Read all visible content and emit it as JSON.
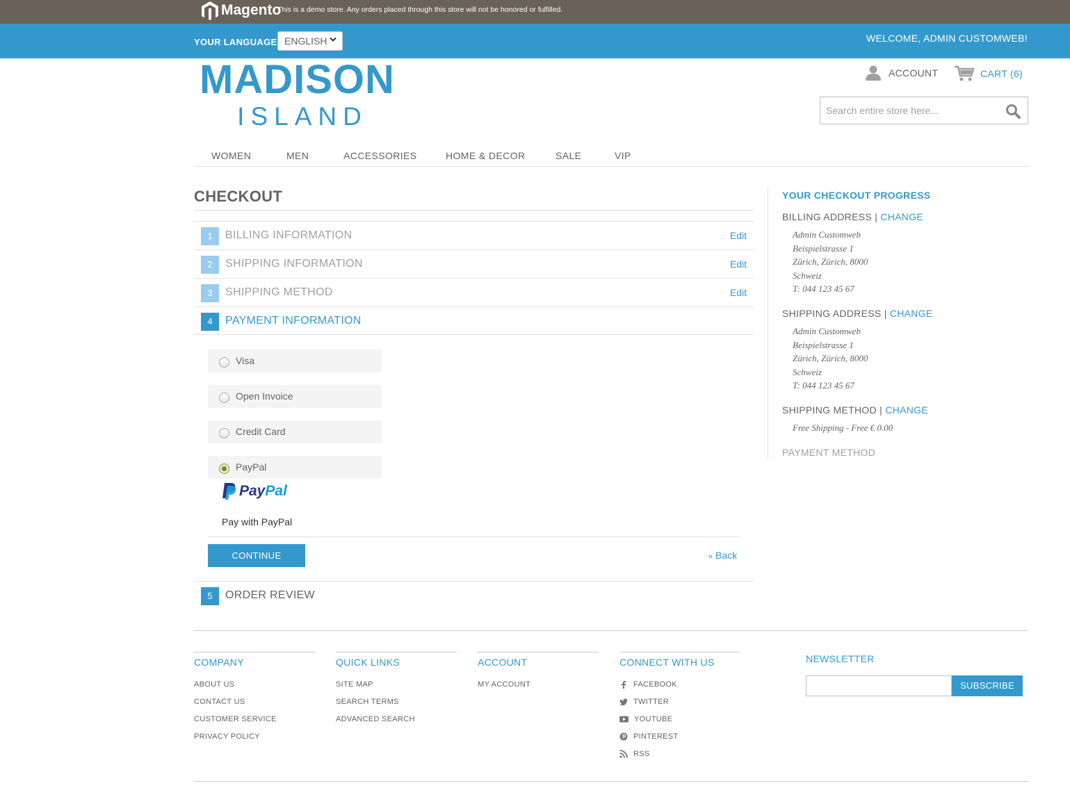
{
  "demo_notice": {
    "brand": "Magento",
    "text": "This is a demo store. Any orders placed through this store will not be honored or fulfilled."
  },
  "language": {
    "label": "YOUR LANGUAGE:",
    "selected": "ENGLISH"
  },
  "welcome": "WELCOME, ADMIN CUSTOMWEB!",
  "logo": {
    "top": "MADISON",
    "bottom": "ISLAND"
  },
  "header": {
    "account_label": "ACCOUNT",
    "cart_label": "CART (6)",
    "search_placeholder": "Search entire store here..."
  },
  "nav": [
    "WOMEN",
    "MEN",
    "ACCESSORIES",
    "HOME & DECOR",
    "SALE",
    "VIP"
  ],
  "checkout": {
    "title": "CHECKOUT",
    "steps": [
      {
        "num": "1",
        "label": "BILLING INFORMATION",
        "edit": "Edit"
      },
      {
        "num": "2",
        "label": "SHIPPING INFORMATION",
        "edit": "Edit"
      },
      {
        "num": "3",
        "label": "SHIPPING METHOD",
        "edit": "Edit"
      },
      {
        "num": "4",
        "label": "PAYMENT INFORMATION"
      },
      {
        "num": "5",
        "label": "ORDER REVIEW"
      }
    ],
    "payment_options": [
      "Visa",
      "Open Invoice",
      "Credit Card",
      "PayPal"
    ],
    "selected_payment": "PayPal",
    "paypal_logo_text": "PayPal",
    "pay_with": "Pay with PayPal",
    "continue_label": "CONTINUE",
    "back_label": "Back"
  },
  "progress": {
    "title": "YOUR CHECKOUT PROGRESS",
    "change_label": "CHANGE",
    "billing_heading": "BILLING ADDRESS",
    "billing_address": [
      "Admin Customweb",
      "Beispielstrasse 1",
      "Zürich, Zürich, 8000",
      "Schweiz",
      "T: 044 123 45 67"
    ],
    "shipping_heading": "SHIPPING ADDRESS",
    "shipping_address": [
      "Admin Customweb",
      "Beispielstrasse 1",
      "Zürich, Zürich, 8000",
      "Schweiz",
      "T: 044 123 45 67"
    ],
    "method_heading": "SHIPPING METHOD",
    "method_value": "Free Shipping - Free € 0.00",
    "payment_heading": "PAYMENT METHOD"
  },
  "footer": {
    "company": {
      "title": "COMPANY",
      "links": [
        "ABOUT US",
        "CONTACT US",
        "CUSTOMER SERVICE",
        "PRIVACY POLICY"
      ]
    },
    "quick_links": {
      "title": "QUICK LINKS",
      "links": [
        "SITE MAP",
        "SEARCH TERMS",
        "ADVANCED SEARCH"
      ]
    },
    "account": {
      "title": "ACCOUNT",
      "links": [
        "MY ACCOUNT"
      ]
    },
    "connect": {
      "title": "CONNECT WITH US",
      "links": [
        "FACEBOOK",
        "TWITTER",
        "YOUTUBE",
        "PINTEREST",
        "RSS"
      ]
    },
    "newsletter": {
      "title": "NEWSLETTER",
      "button": "SUBSCRIBE"
    }
  },
  "colors": {
    "accent": "#3399cc",
    "demo_bar": "#6a6259",
    "text": "#636363",
    "muted": "#a0a0a0",
    "paypal_dark": "#253b80",
    "paypal_light": "#179bd7"
  }
}
